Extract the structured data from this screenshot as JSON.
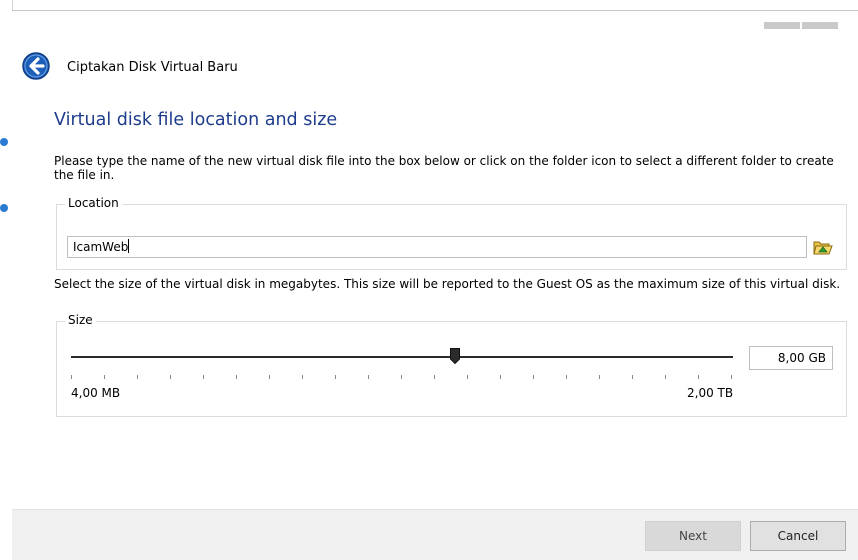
{
  "dialog": {
    "title": "Ciptakan Disk Virtual Baru",
    "heading": "Virtual disk file location and size",
    "location_description": "Please type the name of the new virtual disk file into the box below or click on the folder icon to select a different folder to create the file in.",
    "location": {
      "group_label": "Location",
      "value": "IcamWeb",
      "folder_icon": "folder-open-icon"
    },
    "size_description": "Select the size of the virtual disk in megabytes. This size will be reported to the Guest OS as the maximum size of this virtual disk.",
    "size": {
      "group_label": "Size",
      "value": "8,00 GB",
      "min_label": "4,00 MB",
      "max_label": "2,00 TB",
      "slider_fraction": 0.58
    },
    "buttons": {
      "next": "Next",
      "cancel": "Cancel"
    },
    "back_icon": "back-arrow-icon"
  },
  "colors": {
    "heading": "#1e3c8c",
    "back_button": "#1d5fb8",
    "footer": "#f0f0f0"
  }
}
